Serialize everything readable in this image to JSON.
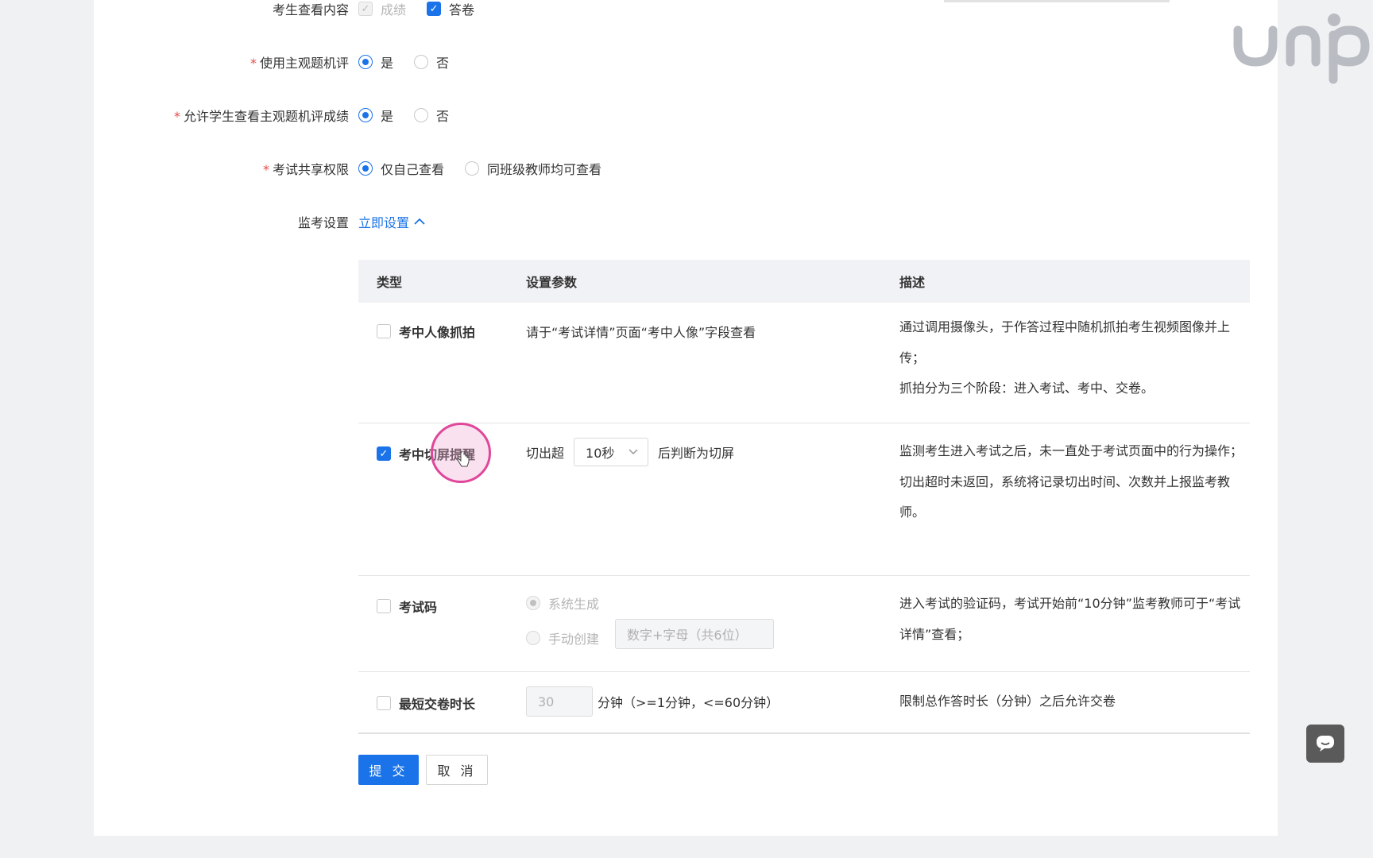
{
  "form": {
    "view_content": {
      "label": "考生查看内容",
      "opt1": "成绩",
      "opt2": "答卷"
    },
    "subjective_ai": {
      "label": "使用主观题机评",
      "yes": "是",
      "no": "否"
    },
    "allow_view_ai": {
      "label": "允许学生查看主观题机评成绩",
      "yes": "是",
      "no": "否"
    },
    "share": {
      "label": "考试共享权限",
      "opt1": "仅自己查看",
      "opt2": "同班级教师均可查看"
    },
    "proctor": {
      "label": "监考设置",
      "link": "立即设置"
    },
    "required_mark": "*"
  },
  "table": {
    "headers": {
      "type": "类型",
      "param": "设置参数",
      "desc": "描述"
    },
    "rows": {
      "capture": {
        "name": "考中人像抓拍",
        "param": "请于“考试详情”页面“考中人像”字段查看",
        "desc1": "通过调用摄像头，于作答过程中随机抓拍考生视频图像并上传；",
        "desc2": "抓拍分为三个阶段：进入考试、考中、交卷。"
      },
      "switch": {
        "name": "考中切屏提醒",
        "prefix": "切出超",
        "select_value": "10秒",
        "suffix": "后判断为切屏",
        "desc1": "监测考生进入考试之后，未一直处于考试页面中的行为操作；",
        "desc2": "切出超时未返回，系统将记录切出时间、次数并上报监考教师。"
      },
      "code": {
        "name": "考试码",
        "opt1": "系统生成",
        "opt2": "手动创建",
        "placeholder": "数字+字母（共6位）",
        "desc1": "进入考试的验证码，考试开始前“10分钟”监考教师可于“考试详情”查看；"
      },
      "min_time": {
        "name": "最短交卷时长",
        "value": "30",
        "unit": "分钟（>=1分钟，<=60分钟）",
        "desc1": "限制总作答时长（分钟）之后允许交卷"
      }
    }
  },
  "buttons": {
    "submit": "提 交",
    "cancel": "取 消"
  },
  "icons": {
    "chevron": "chevron-up-icon",
    "dropdown": "chevron-down-icon",
    "chat": "chat-icon",
    "logo": "unipus-logo"
  },
  "colors": {
    "primary": "#1a73e8",
    "required": "#e84a4a",
    "header_bg": "#f1f2f5"
  }
}
